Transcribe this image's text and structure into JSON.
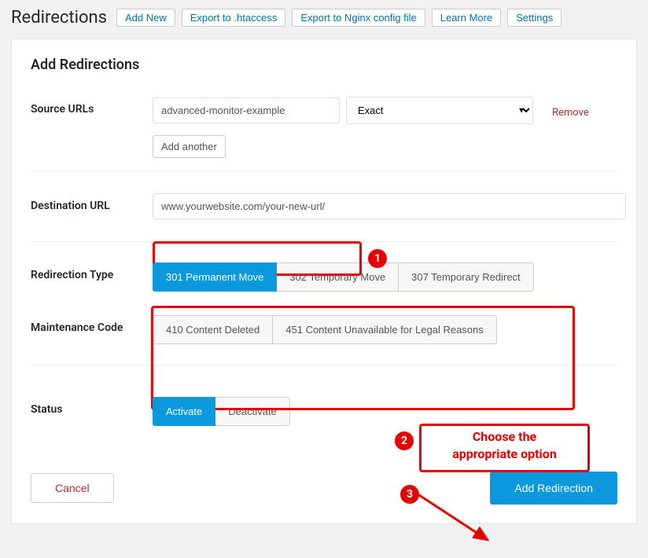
{
  "header": {
    "title": "Redirections",
    "buttons": [
      "Add New",
      "Export to .htaccess",
      "Export to Nginx config file",
      "Learn More",
      "Settings"
    ]
  },
  "panel": {
    "title": "Add Redirections",
    "sourceLabel": "Source URLs",
    "sourceValue": "advanced-monitor-example",
    "matchType": "Exact",
    "removeText": "Remove",
    "addAnother": "Add another",
    "destLabel": "Destination URL",
    "destValue": "www.yourwebsite.com/your-new-url/",
    "typeLabel": "Redirection Type",
    "typeOptions": [
      "301 Permanent Move",
      "302 Temporary Move",
      "307 Temporary Redirect"
    ],
    "maintLabel": "Maintenance Code",
    "maintOptions": [
      "410 Content Deleted",
      "451 Content Unavailable for Legal Reasons"
    ],
    "statusLabel": "Status",
    "statusOptions": [
      "Activate",
      "Deactivate"
    ],
    "cancel": "Cancel",
    "submit": "Add Redirection"
  },
  "annotations": {
    "n1": "1",
    "n2": "2",
    "n3": "3",
    "textLine1": "Choose the",
    "textLine2": "appropriate option"
  }
}
